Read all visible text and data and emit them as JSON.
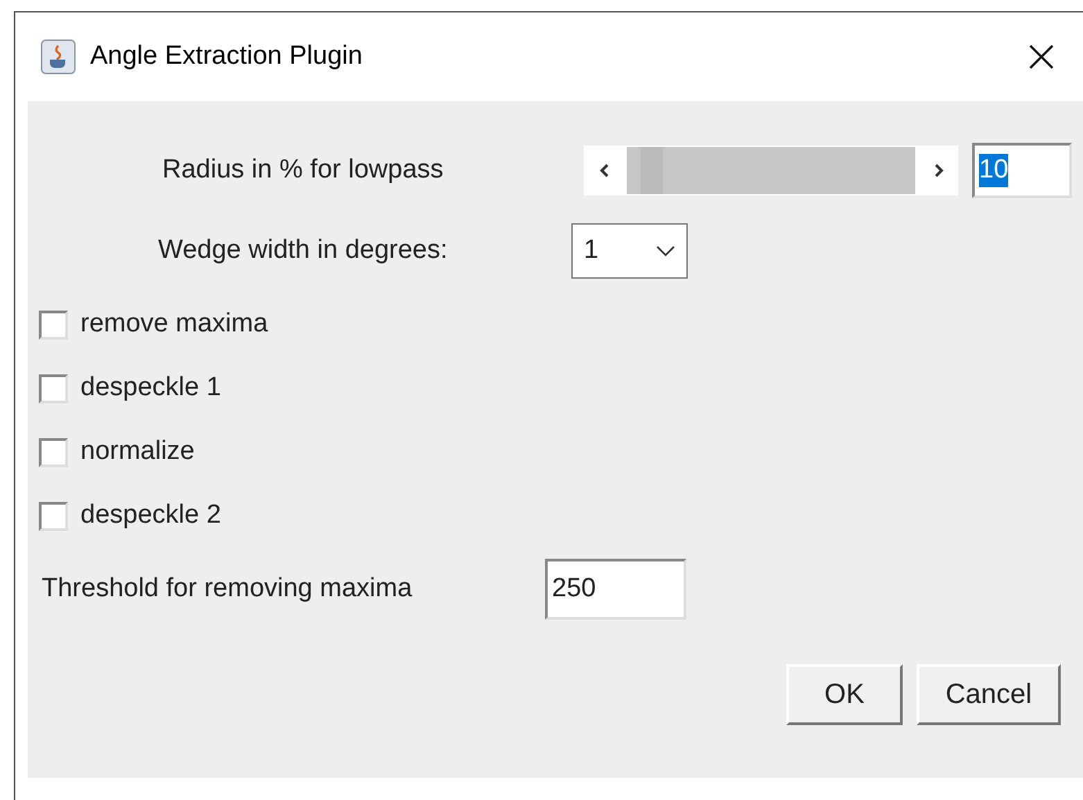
{
  "window": {
    "title": "Angle Extraction Plugin"
  },
  "radius": {
    "label": "Radius in % for lowpass",
    "level": 0.05,
    "value": "10",
    "value_selected": true
  },
  "wedge": {
    "label": "Wedge width in degrees:",
    "value": "1"
  },
  "checkboxes": [
    {
      "label": "remove maxima",
      "checked": false
    },
    {
      "label": "despeckle 1",
      "checked": false
    },
    {
      "label": "normalize",
      "checked": false
    },
    {
      "label": "despeckle 2",
      "checked": false
    }
  ],
  "threshold": {
    "label": "Threshold for removing maxima",
    "value": "250"
  },
  "buttons": [
    "OK",
    "Cancel"
  ]
}
